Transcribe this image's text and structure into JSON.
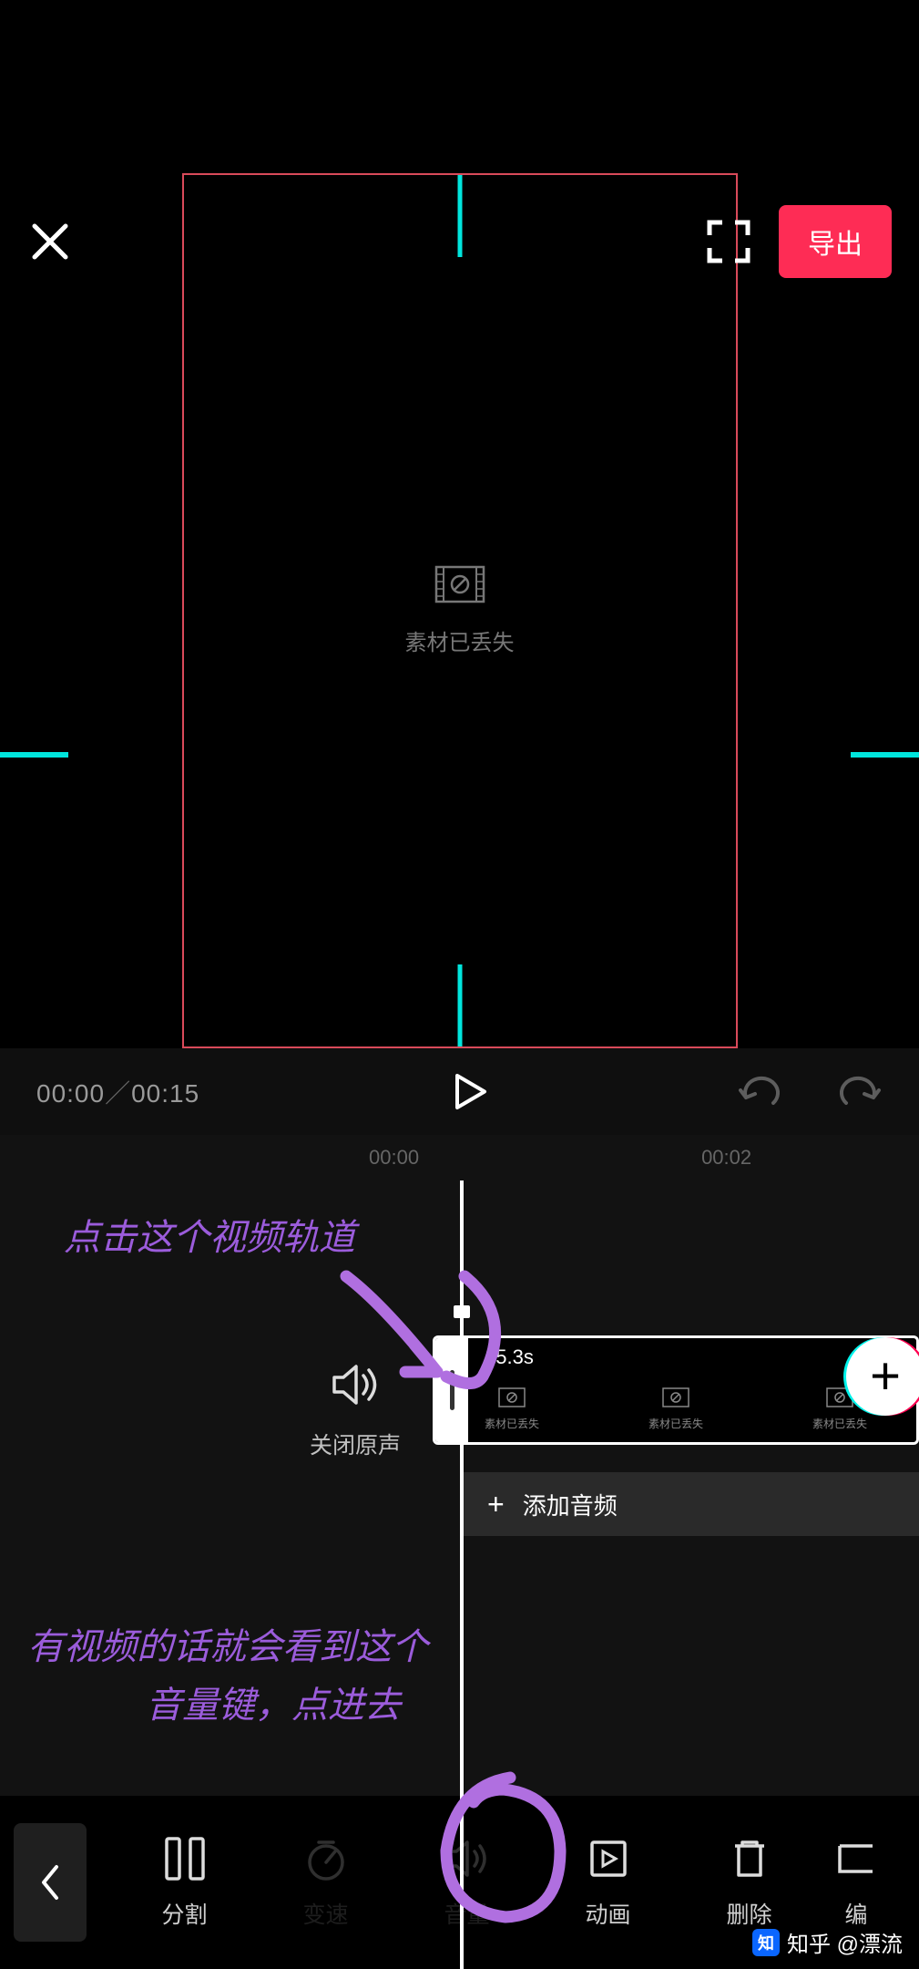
{
  "header": {
    "export_label": "导出"
  },
  "preview": {
    "missing_label": "素材已丢失"
  },
  "playback": {
    "current": "00:00",
    "total": "00:15"
  },
  "ruler": {
    "t0": "00:00",
    "t1": "00:02"
  },
  "mute_original": {
    "label": "关闭原声"
  },
  "track": {
    "duration_label": "15.3s",
    "thumb_caption": "素材已丢失"
  },
  "audio_row": {
    "label": "添加音频"
  },
  "toolbar": {
    "items": [
      {
        "label": "分割",
        "enabled": true
      },
      {
        "label": "变速",
        "enabled": false
      },
      {
        "label": "音量",
        "enabled": false
      },
      {
        "label": "动画",
        "enabled": true
      },
      {
        "label": "删除",
        "enabled": true
      },
      {
        "label": "编",
        "enabled": true
      }
    ]
  },
  "annotations": {
    "line1": "点击这个视频轨道",
    "line2a": "有视频的话就会看到这个",
    "line2b": "音量键，点进去"
  },
  "watermark": {
    "text": "知乎 @漂流"
  }
}
